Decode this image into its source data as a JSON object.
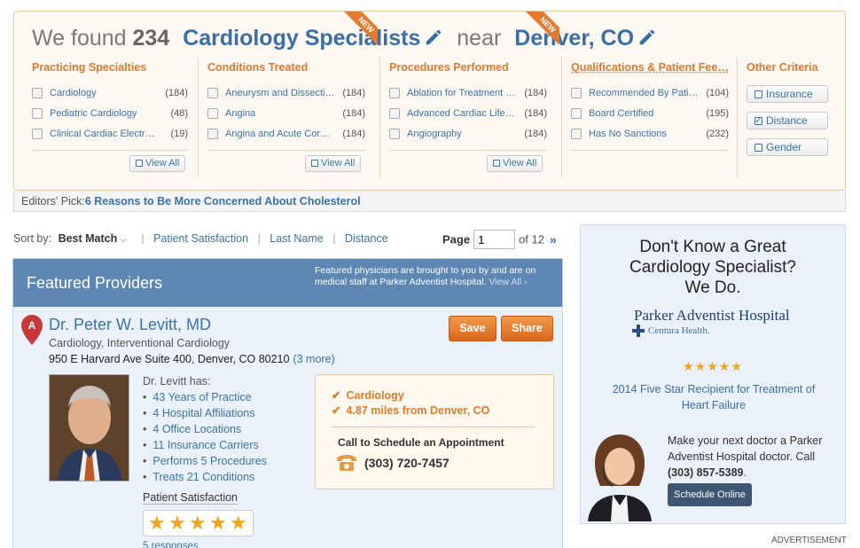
{
  "search": {
    "prefix": "We found",
    "count": "234",
    "specialty": "Cardiology Specialists",
    "near": "near",
    "location": "Denver, CO"
  },
  "filters": {
    "practicing": {
      "title": "Practicing Specialties",
      "items": [
        {
          "label": "Cardiology",
          "count": "(184)"
        },
        {
          "label": "Pediatric Cardiology",
          "count": "(48)"
        },
        {
          "label": "Clinical Cardiac Electro…",
          "count": "(19)"
        }
      ],
      "view_all": "View All"
    },
    "conditions": {
      "title": "Conditions Treated",
      "badge": "NEW",
      "items": [
        {
          "label": "Aneurysm and Dissecti…",
          "count": "(184)"
        },
        {
          "label": "Angina",
          "count": "(184)"
        },
        {
          "label": "Angina and Acute Coro…",
          "count": "(184)"
        }
      ],
      "view_all": "View All"
    },
    "procedures": {
      "title": "Procedures Performed",
      "badge": "NEW",
      "items": [
        {
          "label": "Ablation for Treatment …",
          "count": "(184)"
        },
        {
          "label": "Advanced Cardiac Life …",
          "count": "(184)"
        },
        {
          "label": "Angiography",
          "count": "(184)"
        }
      ],
      "view_all": "View All"
    },
    "qualifications": {
      "title": "Qualifications & Patient Fee…",
      "items": [
        {
          "label": "Recommended By Patie…",
          "count": "(104)"
        },
        {
          "label": "Board Certified",
          "count": "(195)"
        },
        {
          "label": "Has No Sanctions",
          "count": "(232)"
        }
      ]
    },
    "other": {
      "title": "Other Criteria",
      "buttons": [
        {
          "label": "Insurance",
          "checked": false
        },
        {
          "label": "Distance",
          "checked": true
        },
        {
          "label": "Gender",
          "checked": false
        }
      ]
    }
  },
  "editors_pick": {
    "label": "Editors' Pick:",
    "link": "6 Reasons to Be More Concerned About Cholesterol"
  },
  "sort": {
    "label": "Sort by:",
    "selected": "Best Match",
    "options": [
      "Patient Satisfaction",
      "Last Name",
      "Distance"
    ]
  },
  "pager": {
    "label": "Page",
    "current": "1",
    "of": "of 12",
    "next": "»"
  },
  "featured": {
    "title": "Featured Providers",
    "note": "Featured physicians are brought to you by and are on medical staff at Parker Adventist Hospital.",
    "note_link": "View All ›",
    "provider": {
      "pin_letter": "A",
      "name": "Dr. Peter W. Levitt, MD",
      "specialties": "Cardiology, Interventional Cardiology",
      "address": "950 E Harvard Ave Suite 400, Denver, CO 80210",
      "more": "(3 more)",
      "save": "Save",
      "share": "Share",
      "has_label": "Dr. Levitt has:",
      "stats": [
        "43 Years of Practice",
        "4 Hospital Affiliations",
        "4 Office Locations",
        "11 Insurance Carriers",
        "Performs 5 Procedures",
        "Treats 21 Conditions"
      ],
      "satisfaction_label": "Patient Satisfaction",
      "rating": 5,
      "responses": "5 responses",
      "match_specialty": "Cardiology",
      "match_distance": "4.87 miles from Denver, CO",
      "call_label": "Call to Schedule an Appointment",
      "phone": "(303) 720-7457"
    }
  },
  "ad": {
    "headline": "Don't Know a Great Cardiology Specialist? We Do.",
    "hospital": "Parker Adventist Hospital",
    "system": "Centura Health.",
    "stars": "★★★★★",
    "award": "2014 Five Star Recipient for Treatment of Heart Failure",
    "copy": "Make your next doctor a Parker Adventist Hospital doctor. Call",
    "phone": "(303) 857-5389",
    "button": "Schedule Online",
    "tag": "ADVERTISEMENT"
  },
  "colors": {
    "accent_orange": "#e0782e",
    "link_blue": "#3b73a8",
    "header_blue": "#5f87b4",
    "star_gold": "#f0a51b"
  }
}
